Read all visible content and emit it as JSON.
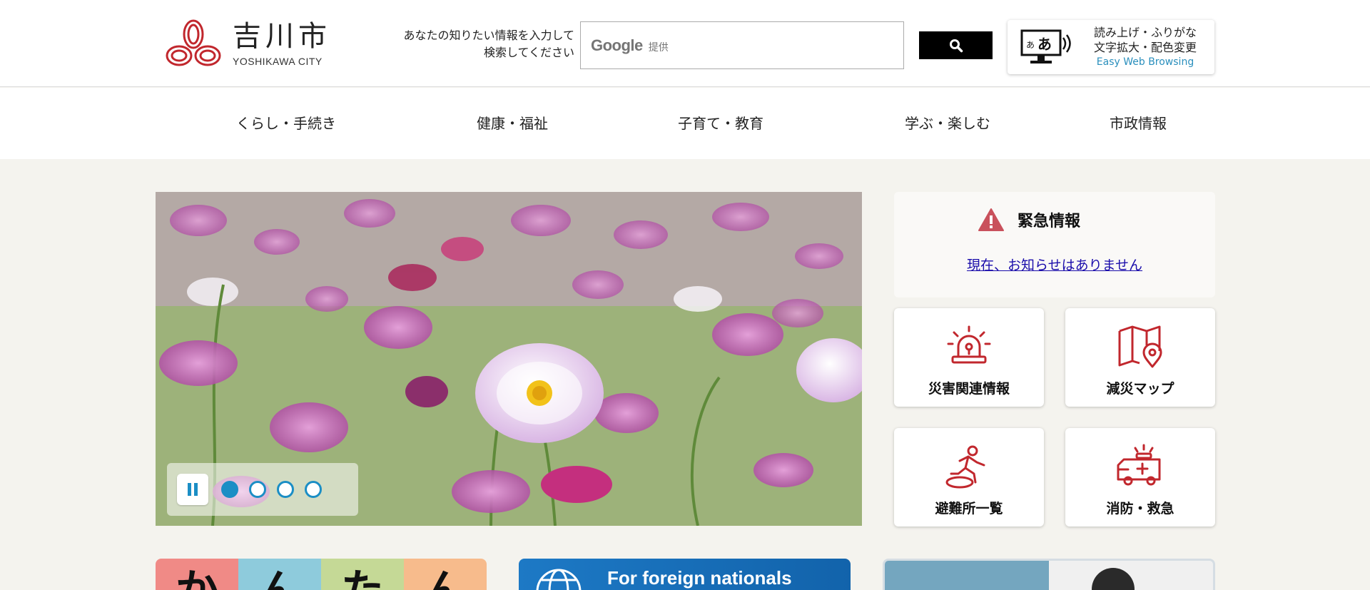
{
  "header": {
    "logo_jp": "吉川市",
    "logo_en": "YOSHIKAWA CITY",
    "search_hint_line1": "あなたの知りたい情報を入力して",
    "search_hint_line2": "検索してください",
    "search_google": "Google",
    "search_provided": "提供",
    "search_placeholder": "",
    "search_button_icon": "search-icon",
    "ewb_line1": "読み上げ・ふりがな",
    "ewb_line2": "文字拡大・配色変更",
    "ewb_en": "Easy Web Browsing"
  },
  "nav": {
    "items": [
      {
        "label": "くらし・手続き"
      },
      {
        "label": "健康・福祉"
      },
      {
        "label": "子育て・教育"
      },
      {
        "label": "学ぶ・楽しむ"
      },
      {
        "label": "市政情報"
      }
    ]
  },
  "slideshow": {
    "total_slides": 4,
    "active_slide": 1,
    "pause_icon": "pause-icon"
  },
  "emergency": {
    "title": "緊急情報",
    "message": "現在、お知らせはありません"
  },
  "tiles": [
    {
      "label": "災害関連情報",
      "icon": "siren-icon"
    },
    {
      "label": "減災マップ",
      "icon": "map-pin-icon"
    },
    {
      "label": "避難所一覧",
      "icon": "evacuation-runner-icon"
    },
    {
      "label": "消防・救急",
      "icon": "ambulance-icon"
    }
  ],
  "banners": {
    "kantan_chars": [
      "か",
      "ん",
      "た",
      "ん"
    ],
    "kantan_colors": [
      "#f08a86",
      "#8ecbdc",
      "#c5d996",
      "#f7bb8c"
    ],
    "foreign_text": "For foreign nationals"
  },
  "colors": {
    "accent_red": "#c1272d",
    "accent_blue": "#1b8ec5",
    "page_bg": "#f4f3ee"
  }
}
